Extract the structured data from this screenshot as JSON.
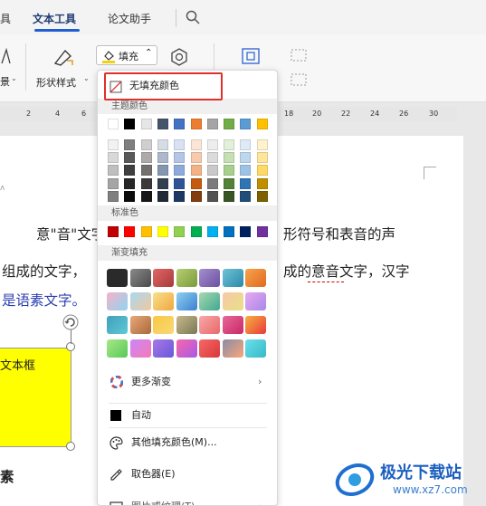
{
  "tabs": [
    "具",
    "文本工具",
    "论文助手"
  ],
  "ribbon": {
    "fill_label": "填充",
    "shape_style_label": "形状样式",
    "left_label": "景"
  },
  "ruler": [
    "2",
    "4",
    "6",
    "8",
    "10",
    "12",
    "14",
    "16",
    "18",
    "20",
    "22",
    "24",
    "26",
    "28",
    "30"
  ],
  "doc": {
    "line1a": "意\"音\"文字",
    "line1b": "形符号和表音的声",
    "line2a": "组成的文字，",
    "line2b": "成的意音文字，汉字",
    "line3": "是语素文字。",
    "textbox_label": "文本框",
    "bottom_label": "素"
  },
  "menu": {
    "no_fill": "无填充颜色",
    "theme_colors_title": "主题颜色",
    "theme_top": [
      "#ffffff",
      "#000000",
      "#e7e6e6",
      "#44546a",
      "#4472c4",
      "#ed7d31",
      "#a5a5a5",
      "#70ad47",
      "#5b9bd5",
      "#ffc000"
    ],
    "theme_shades": [
      [
        "#f2f2f2",
        "#7f7f7f",
        "#d0cece",
        "#d6dce4",
        "#d9e2f3",
        "#fbe5d5",
        "#ededed",
        "#e2efd9",
        "#deebf6",
        "#fff2cc"
      ],
      [
        "#d8d8d8",
        "#595959",
        "#aeaaaa",
        "#adb9ca",
        "#b4c6e7",
        "#f7caac",
        "#dbdbdb",
        "#c5e0b3",
        "#bdd7ee",
        "#fee599"
      ],
      [
        "#bfbfbf",
        "#3f3f3f",
        "#757070",
        "#8496b0",
        "#8eaadb",
        "#f4b183",
        "#c9c9c9",
        "#a8d08d",
        "#9cc3e5",
        "#ffd965"
      ],
      [
        "#a5a5a5",
        "#262626",
        "#3a3838",
        "#323f4f",
        "#2f5496",
        "#c55a11",
        "#7b7b7b",
        "#538135",
        "#2e75b5",
        "#bf8f00"
      ],
      [
        "#7f7f7f",
        "#0c0c0c",
        "#171616",
        "#222a35",
        "#1e3864",
        "#833c0b",
        "#525252",
        "#375623",
        "#1e4e79",
        "#7f6000"
      ]
    ],
    "standard_title": "标准色",
    "standard": [
      "#c00000",
      "#ff0000",
      "#ffc000",
      "#ffff00",
      "#92d050",
      "#00b050",
      "#00b0f0",
      "#0070c0",
      "#002060",
      "#7030a0"
    ],
    "gradient_title": "渐变填充",
    "more_gradients": "更多渐变",
    "auto": "自动",
    "other_colors": "其他填充颜色(M)...",
    "eyedropper": "取色器(E)",
    "picture_fill": "图片或纹理(T)"
  },
  "watermark": {
    "brand": "极光下载站",
    "url": "www.xz7.com"
  }
}
